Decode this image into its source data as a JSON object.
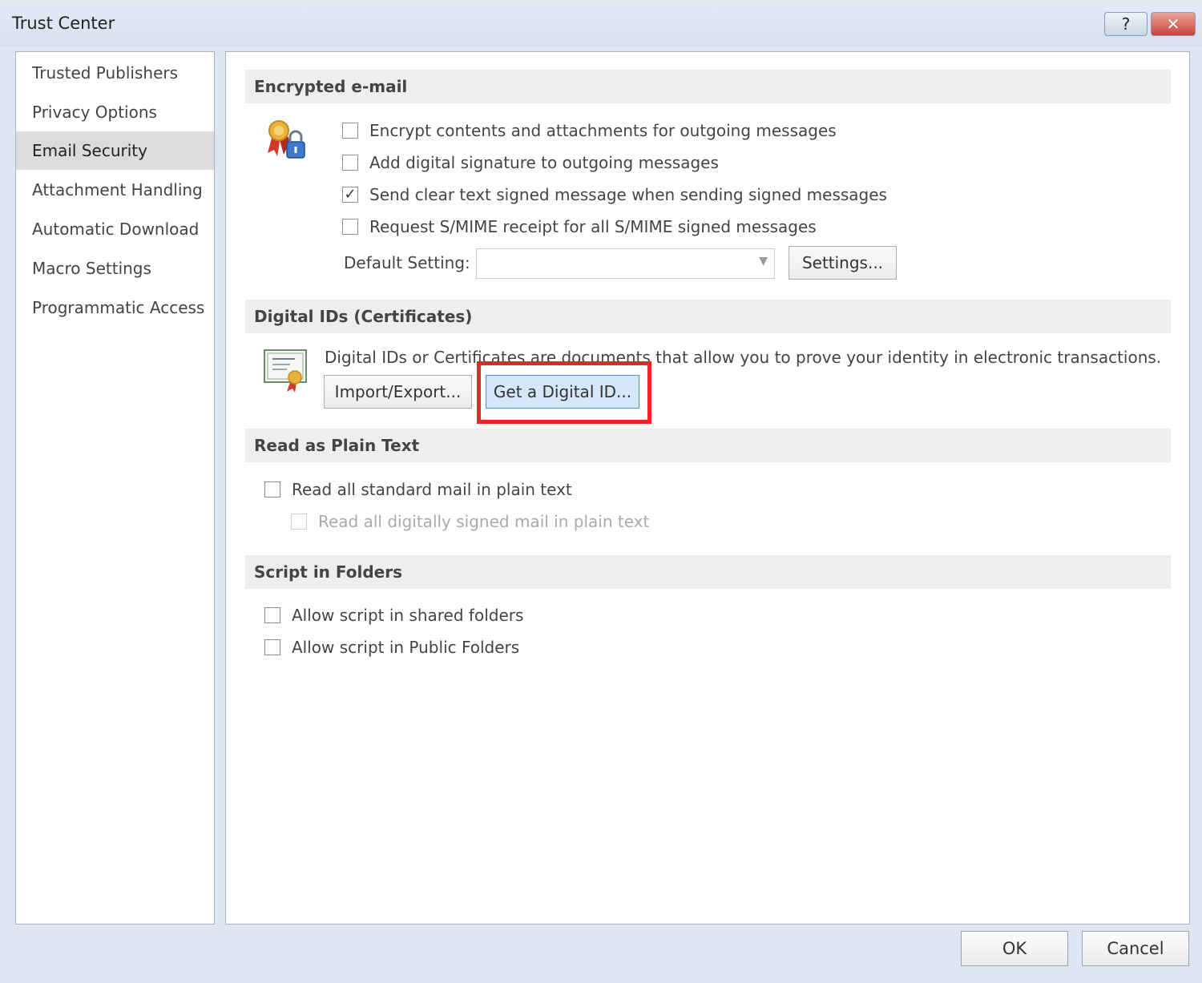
{
  "window": {
    "title": "Trust Center",
    "help_label": "?",
    "close_label": "✕"
  },
  "nav": {
    "items": [
      {
        "label": "Trusted Publishers"
      },
      {
        "label": "Privacy Options"
      },
      {
        "label": "Email Security"
      },
      {
        "label": "Attachment Handling"
      },
      {
        "label": "Automatic Download"
      },
      {
        "label": "Macro Settings"
      },
      {
        "label": "Programmatic Access"
      }
    ],
    "selected": "Email Security"
  },
  "encrypted_email": {
    "header": "Encrypted e-mail",
    "icon": "ribbon-lock-icon",
    "options": [
      {
        "label": "Encrypt contents and attachments for outgoing messages",
        "checked": false
      },
      {
        "label": "Add digital signature to outgoing messages",
        "checked": false
      },
      {
        "label": "Send clear text signed message when sending signed messages",
        "checked": true
      },
      {
        "label": "Request S/MIME receipt for all S/MIME signed messages",
        "checked": false
      }
    ],
    "default_setting_label": "Default Setting:",
    "default_setting_value": "",
    "settings_button": "Settings..."
  },
  "digital_ids": {
    "header": "Digital IDs (Certificates)",
    "icon": "certificate-icon",
    "description": "Digital IDs or Certificates are documents that allow you to prove your identity in electronic transactions.",
    "import_export_button": "Import/Export...",
    "get_digital_id_button": "Get a Digital ID..."
  },
  "plain_text": {
    "header": "Read as Plain Text",
    "options": [
      {
        "label": "Read all standard mail in plain text",
        "checked": false,
        "enabled": true
      },
      {
        "label": "Read all digitally signed mail in plain text",
        "checked": false,
        "enabled": false
      }
    ]
  },
  "script_folders": {
    "header": "Script in Folders",
    "options": [
      {
        "label": "Allow script in shared folders",
        "checked": false
      },
      {
        "label": "Allow script in Public Folders",
        "checked": false
      }
    ]
  },
  "footer": {
    "ok": "OK",
    "cancel": "Cancel"
  },
  "colors": {
    "highlight": "#e52626",
    "hover_button": "#d5e8fa",
    "section_header_bg": "#eeeeee"
  }
}
